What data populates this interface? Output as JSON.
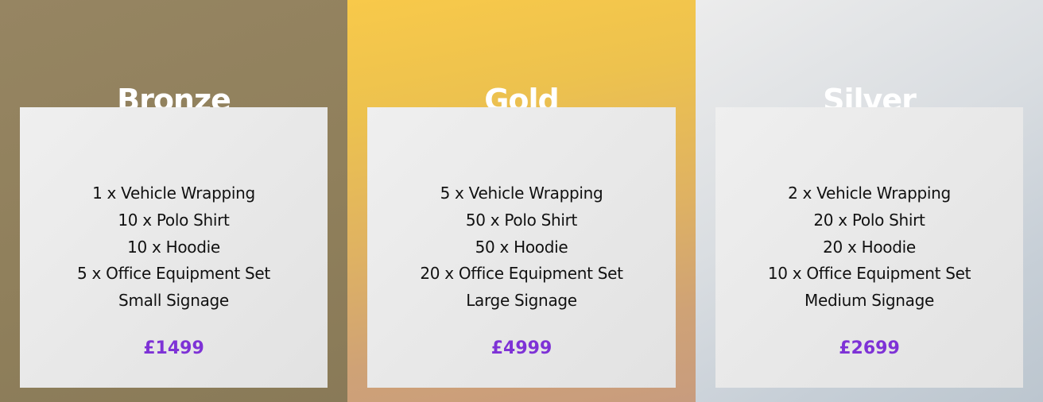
{
  "tiers": [
    {
      "title": "Bronze",
      "items": [
        "1 x Vehicle Wrapping",
        "10 x Polo Shirt",
        "10 x Hoodie",
        "5 x Office Equipment Set",
        "Small Signage"
      ],
      "price": "£1499"
    },
    {
      "title": "Gold",
      "items": [
        "5 x Vehicle Wrapping",
        "50 x Polo Shirt",
        "50 x Hoodie",
        "20 x Office Equipment Set",
        "Large Signage"
      ],
      "price": "£4999"
    },
    {
      "title": "Silver",
      "items": [
        "2 x Vehicle Wrapping",
        "20 x Polo Shirt",
        "20 x Hoodie",
        "10 x Office Equipment Set",
        "Medium Signage"
      ],
      "price": "£2699"
    }
  ],
  "colors": {
    "bronze_bg": "#8f7f5b",
    "gold_bg": "#f3c44e",
    "silver_bg": "#d3d8dd",
    "card_bg": "#ebebeb",
    "price": "#7e32d6",
    "title": "#ffffff"
  }
}
